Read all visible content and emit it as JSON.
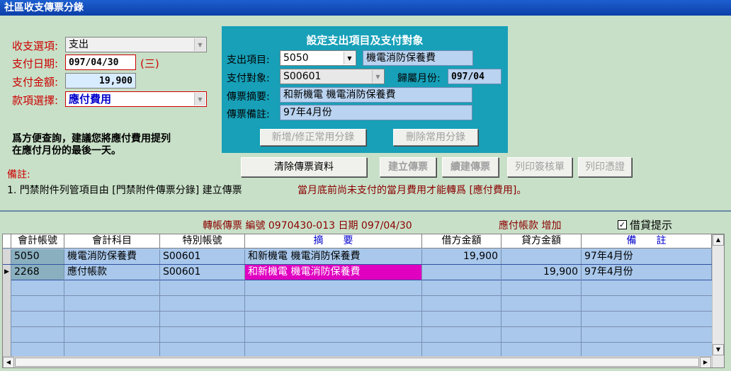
{
  "window": {
    "title": "社區收支傳票分錄"
  },
  "form": {
    "type_label": "收支選項:",
    "type_value": "支出",
    "date_label": "支付日期:",
    "date_value": "097/04/30",
    "weekday": "(三)",
    "amount_label": "支付金額:",
    "amount_value": "19,900",
    "item_label": "款項選擇:",
    "item_value": "應付費用"
  },
  "panel": {
    "title": "設定支出項目及支付對象",
    "expense_label": "支出項目:",
    "expense_code": "5050",
    "expense_name": "機電消防保養費",
    "payee_label": "支付對象:",
    "payee_value": "S00601",
    "month_label": "歸屬月份:",
    "month_value": "097/04",
    "summary_label": "傳票摘要:",
    "summary_value": "和新機電 機電消防保養費",
    "note_label": "傳票備註:",
    "note_value": "97年4月份",
    "add_button": "新增/修正常用分錄",
    "delete_button": "刪除常用分錄"
  },
  "tip": {
    "line1": "爲方便查詢，建議您將應付費用提列",
    "line2": "在應付月份的最後一天。"
  },
  "buttons": {
    "clear": "清除傳票資料",
    "create": "建立傳票",
    "continue": "續建傳票",
    "print_approval": "列印簽核單",
    "print_voucher": "列印憑證"
  },
  "remarks": {
    "label": "備註:",
    "line1": "1. 門禁附件列管項目由 [門禁附件傳票分錄] 建立傳票",
    "warning": "當月底前尚未支付的當月費用才能轉爲 [應付費用]。"
  },
  "voucher": {
    "info": "轉帳傳票 編號 0970430-013 日期 097/04/30",
    "payable": "應付帳款 增加",
    "checkbox_label": "借貸提示",
    "checkbox_checked": true
  },
  "grid": {
    "headers": [
      "會計帳號",
      "會計科目",
      "特別帳號",
      "摘　　要",
      "借方金額",
      "貸方金額",
      "備　　註"
    ],
    "rows": [
      {
        "account": "5050",
        "subject": "機電消防保養費",
        "special": "S00601",
        "summary": "和新機電  機電消防保養費",
        "debit": "19,900",
        "credit": "",
        "note": "97年4月份"
      },
      {
        "account": "2268",
        "subject": "應付帳款",
        "special": "S00601",
        "summary": "和新機電  機電消防保養費",
        "debit": "",
        "credit": "19,900",
        "note": "97年4月份"
      }
    ]
  },
  "colors": {
    "background": "#c8e0c8",
    "panel": "#17a0b8",
    "label_red": "#cc0000",
    "selected_cell": "#e000c0",
    "grid_bg": "#a9c8ec"
  }
}
